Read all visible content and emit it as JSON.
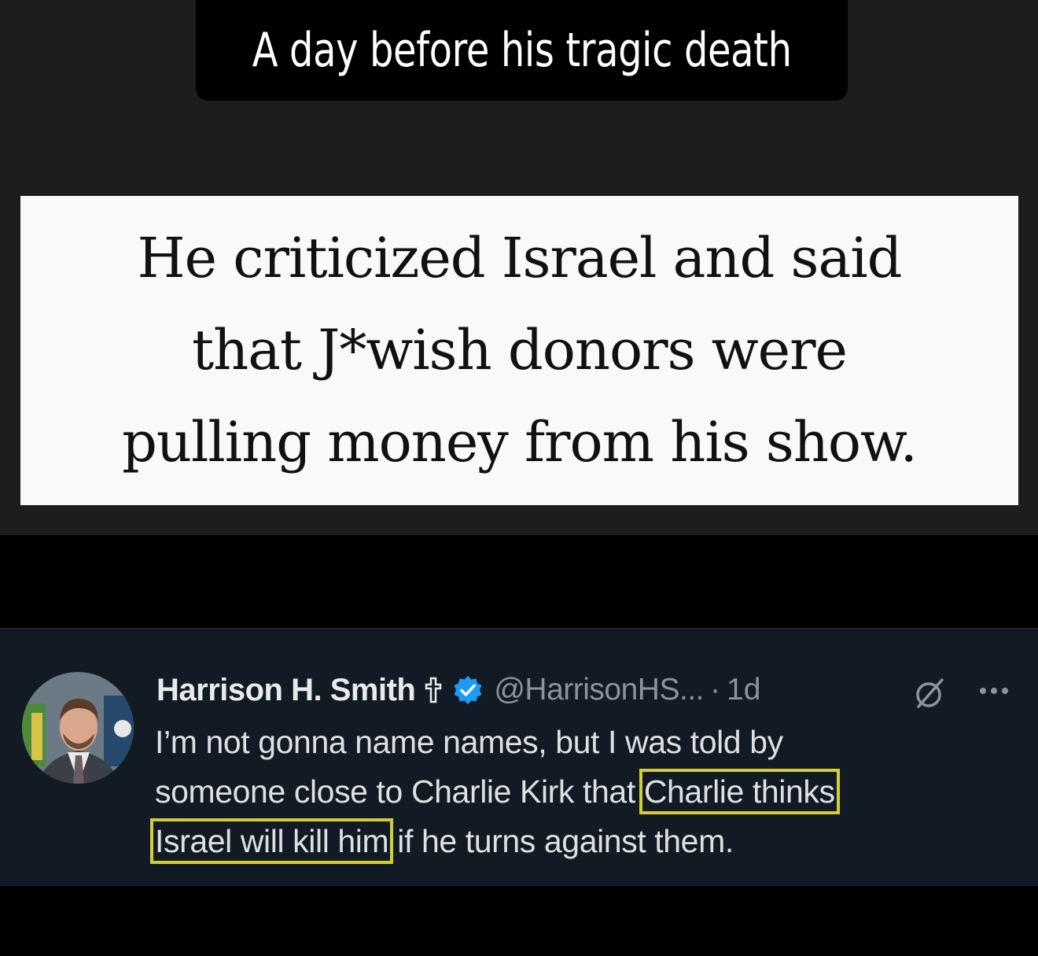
{
  "caption": {
    "text": "A day before his tragic death"
  },
  "quote_card": {
    "lines": [
      "He criticized Israel and said",
      "that J*wish donors were",
      "pulling money from his show."
    ]
  },
  "tweet": {
    "author_name": "Harrison H. Smith",
    "author_handle": "@HarrisonHS...",
    "separator": "·",
    "age": "1d",
    "body": {
      "line1": "I’m not gonna name names, but I was told by",
      "line2_plain": "someone close to Charlie Kirk that ",
      "line2_highlight": "Charlie thinks",
      "line3_highlight": "Israel will kill him",
      "line3_plain": " if he turns against them."
    },
    "icons": {
      "cross": "cross-icon",
      "verified": "verified-badge-icon",
      "grok": "grok-icon",
      "more": "more-icon"
    }
  },
  "colors": {
    "top_background": "#1d1d1d",
    "caption_background": "#000000",
    "card_background": "#f9f9f9",
    "tweet_background": "#121a24",
    "verified_blue": "#1d9bf0",
    "highlight_outline": "#d4cd36"
  }
}
